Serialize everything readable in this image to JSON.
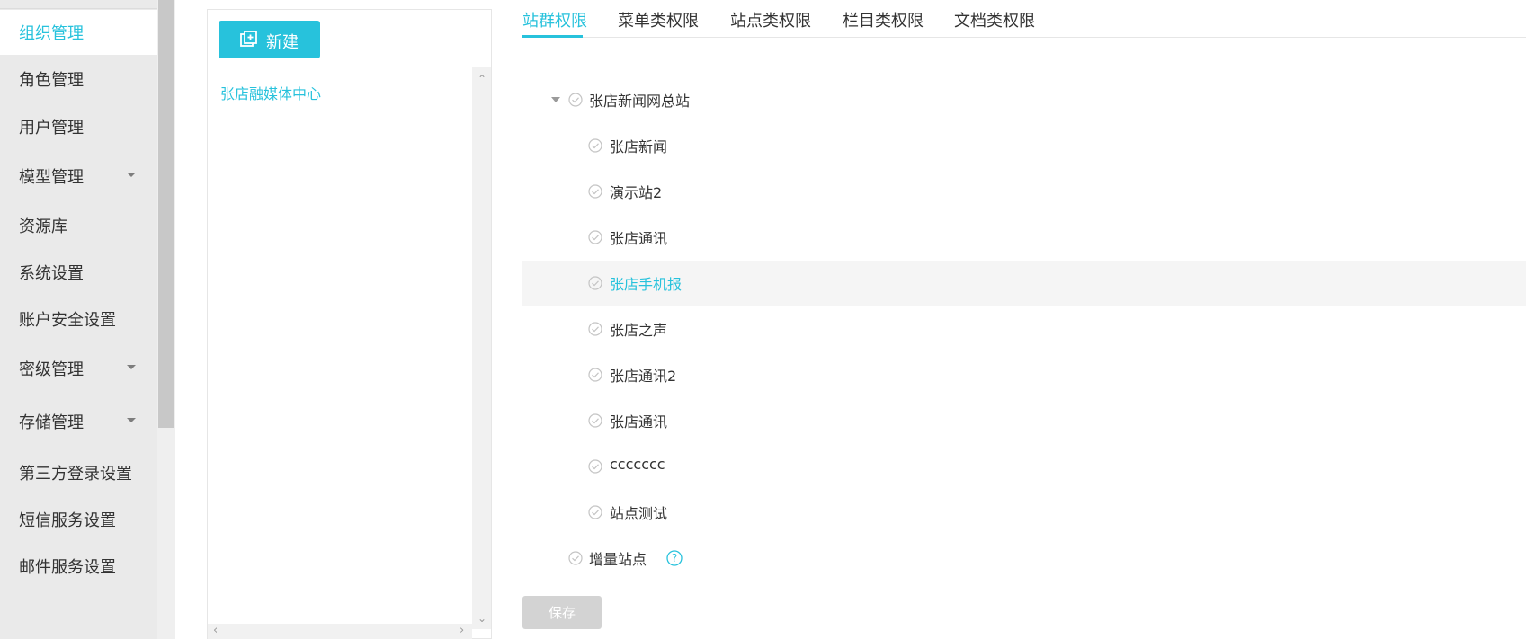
{
  "sidebar": {
    "items": [
      {
        "label": "组织管理",
        "active": true,
        "has_submenu": false
      },
      {
        "label": "角色管理",
        "active": false,
        "has_submenu": false
      },
      {
        "label": "用户管理",
        "active": false,
        "has_submenu": false
      },
      {
        "label": "模型管理",
        "active": false,
        "has_submenu": true
      },
      {
        "label": "资源库",
        "active": false,
        "has_submenu": false
      },
      {
        "label": "系统设置",
        "active": false,
        "has_submenu": false
      },
      {
        "label": "账户安全设置",
        "active": false,
        "has_submenu": false
      },
      {
        "label": "密级管理",
        "active": false,
        "has_submenu": true
      },
      {
        "label": "存储管理",
        "active": false,
        "has_submenu": true
      },
      {
        "label": "第三方登录设置",
        "active": false,
        "has_submenu": false
      },
      {
        "label": "短信服务设置",
        "active": false,
        "has_submenu": false
      },
      {
        "label": "邮件服务设置",
        "active": false,
        "has_submenu": false
      }
    ]
  },
  "org_panel": {
    "new_button_label": "新建",
    "tree": [
      {
        "label": "张店融媒体中心"
      }
    ]
  },
  "tabs": [
    {
      "label": "站群权限",
      "active": true
    },
    {
      "label": "菜单类权限",
      "active": false
    },
    {
      "label": "站点类权限",
      "active": false
    },
    {
      "label": "栏目类权限",
      "active": false
    },
    {
      "label": "文档类权限",
      "active": false
    }
  ],
  "site_tree": {
    "root": {
      "label": "张店新闻网总站",
      "expanded": true
    },
    "children": [
      {
        "label": "张店新闻"
      },
      {
        "label": "演示站2"
      },
      {
        "label": "张店通讯"
      },
      {
        "label": "张店手机报",
        "highlighted": true
      },
      {
        "label": "张店之声"
      },
      {
        "label": "张店通讯2"
      },
      {
        "label": "张店通讯"
      },
      {
        "label": "ccccccc"
      },
      {
        "label": "站点测试"
      }
    ],
    "extra": {
      "label": "增量站点",
      "help_icon": "question-circle-icon"
    }
  },
  "save_button_label": "保存",
  "colors": {
    "accent": "#27c2dc",
    "sidebar_bg": "#eaeaea",
    "disabled_button": "#d3d3d3"
  }
}
